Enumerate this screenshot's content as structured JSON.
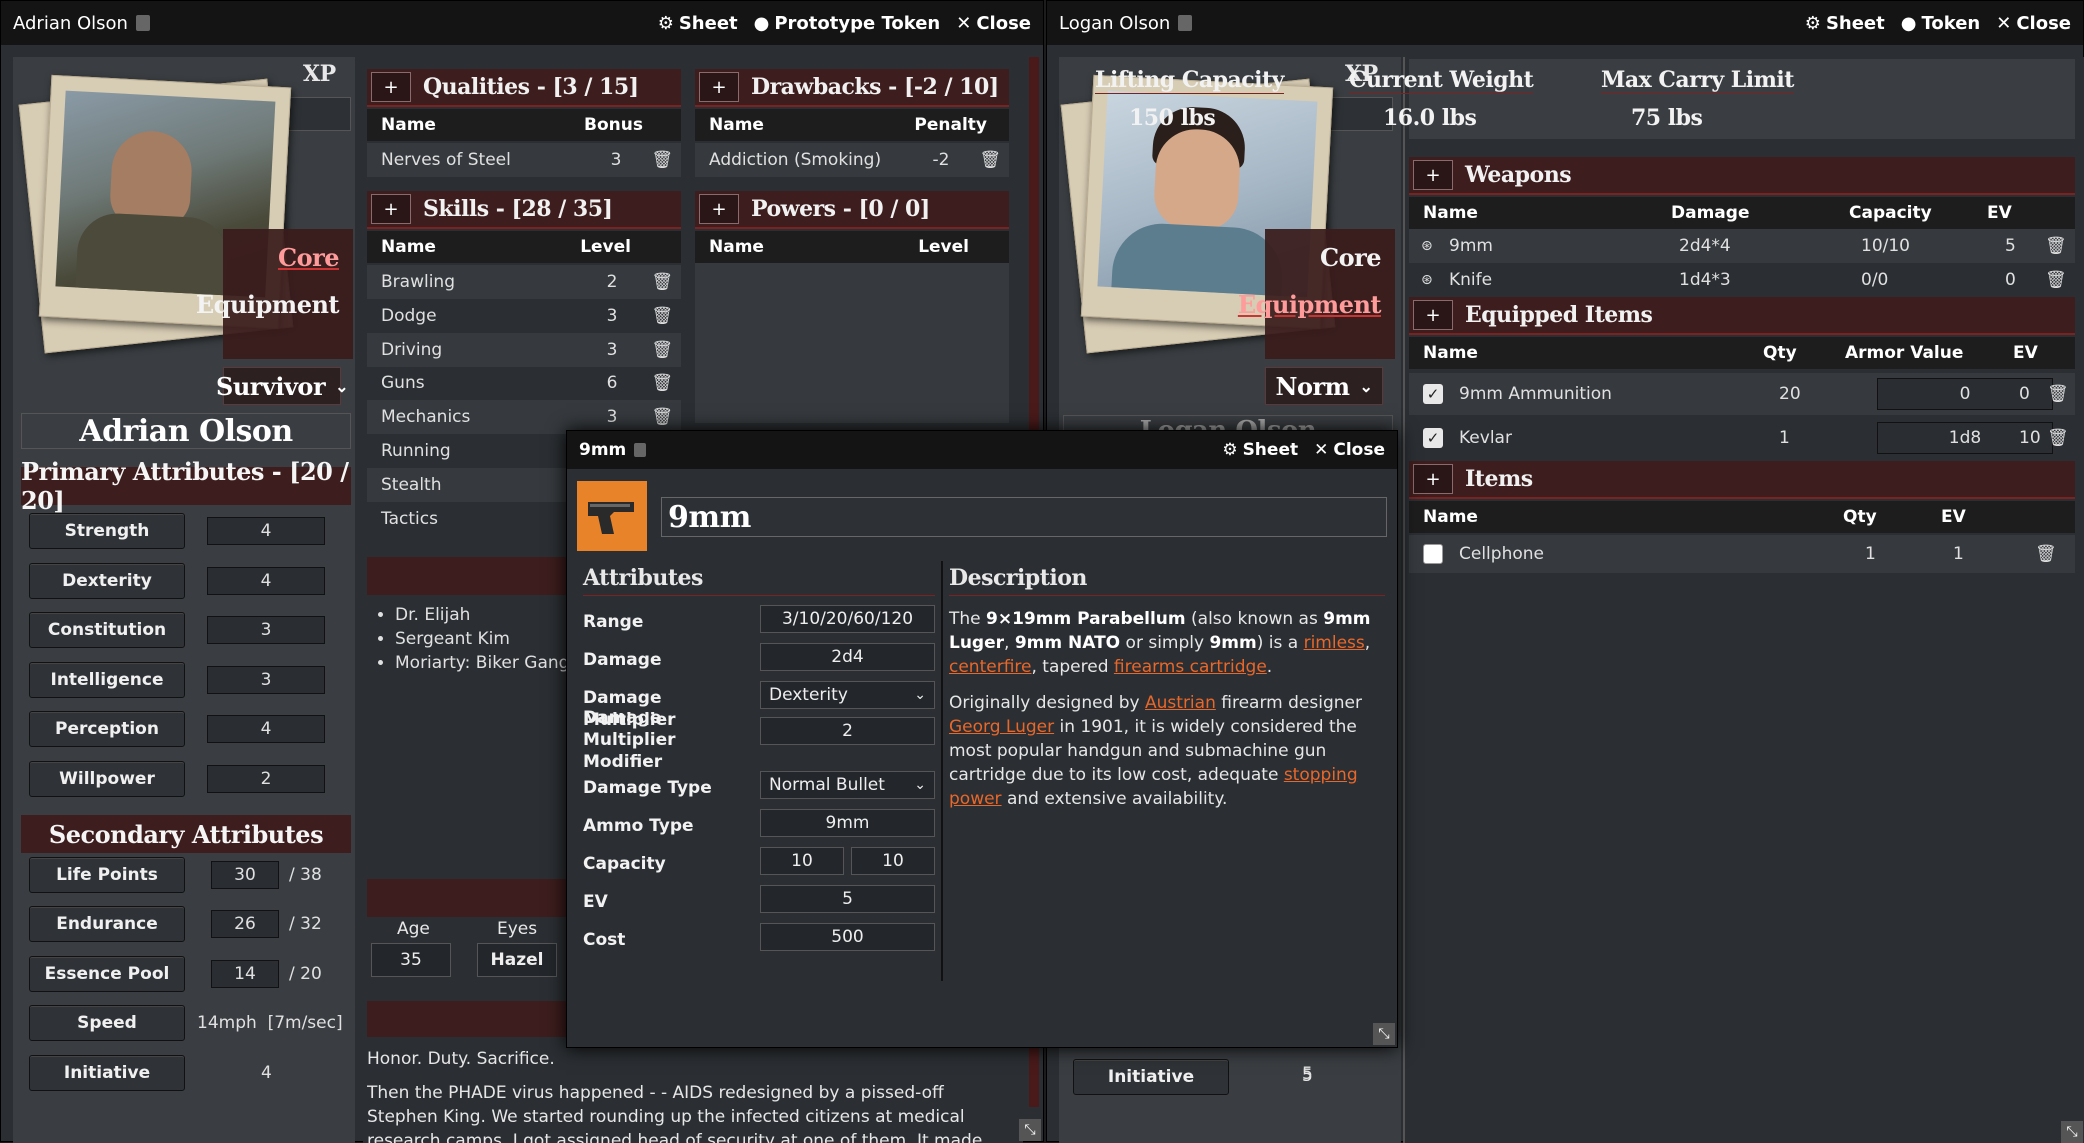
{
  "adrian": {
    "title": "Adrian Olson",
    "actions": [
      "Sheet",
      "Prototype Token",
      "Close"
    ],
    "xp_label": "XP",
    "name": "Adrian Olson",
    "nav": [
      "Core",
      "Equipment"
    ],
    "archetype": "Survivor",
    "primary_header": "Primary Attributes - [20 / 20]",
    "primary": [
      {
        "label": "Strength",
        "value": "4"
      },
      {
        "label": "Dexterity",
        "value": "4"
      },
      {
        "label": "Constitution",
        "value": "3"
      },
      {
        "label": "Intelligence",
        "value": "3"
      },
      {
        "label": "Perception",
        "value": "4"
      },
      {
        "label": "Willpower",
        "value": "2"
      }
    ],
    "secondary_header": "Secondary Attributes",
    "secondary": [
      {
        "label": "Life Points",
        "value": "30",
        "max": "/ 38"
      },
      {
        "label": "Endurance",
        "value": "26",
        "max": "/ 32"
      },
      {
        "label": "Essence Pool",
        "value": "14",
        "max": "/ 20"
      },
      {
        "label": "Speed",
        "value": "14mph  [7m/sec]",
        "max": ""
      },
      {
        "label": "Initiative",
        "value": "4",
        "max": ""
      }
    ],
    "qualities": {
      "title": "Qualities - [3 / 15]",
      "cols": [
        "Name",
        "Bonus"
      ],
      "rows": [
        {
          "name": "Nerves of Steel",
          "val": "3"
        }
      ]
    },
    "drawbacks": {
      "title": "Drawbacks - [-2 / 10]",
      "cols": [
        "Name",
        "Penalty"
      ],
      "rows": [
        {
          "name": "Addiction (Smoking)",
          "val": "-2"
        }
      ]
    },
    "skills": {
      "title": "Skills - [28 / 35]",
      "cols": [
        "Name",
        "Level"
      ],
      "rows": [
        {
          "name": "Brawling",
          "val": "2"
        },
        {
          "name": "Dodge",
          "val": "3"
        },
        {
          "name": "Driving",
          "val": "3"
        },
        {
          "name": "Guns",
          "val": "6"
        },
        {
          "name": "Mechanics",
          "val": "3"
        },
        {
          "name": "Running",
          "val": ""
        },
        {
          "name": "Stealth",
          "val": ""
        },
        {
          "name": "Tactics",
          "val": ""
        }
      ]
    },
    "powers": {
      "title": "Powers - [0 / 0]",
      "cols": [
        "Name",
        "Level"
      ]
    },
    "contacts": [
      "Dr. Elijah",
      "Sergeant Kim",
      "Moriarty: Biker Gang"
    ],
    "bio": {
      "age_label": "Age",
      "age": "35",
      "eyes_label": "Eyes",
      "eyes": "Hazel"
    },
    "motto": "Honor. Duty. Sacrifice.",
    "story": "Then the PHADE virus happened - - AIDS redesigned by a pissed-off Stephen King. We started rounding up the infected citizens at medical research camps. I got assigned head of security at one of them. It made me proud."
  },
  "logan": {
    "title": "Logan Olson",
    "actions": [
      "Sheet",
      "Token",
      "Close"
    ],
    "xp_label": "XP",
    "nav": [
      "Core",
      "Equipment"
    ],
    "archetype": "Norm",
    "name_partial": "Logan Olson",
    "initiative_label": "Initiative",
    "initiative": "5",
    "capacity": [
      {
        "label": "Lifting Capacity",
        "value": "150 lbs"
      },
      {
        "label": "Current Weight",
        "value": "16.0 lbs"
      },
      {
        "label": "Max Carry Limit",
        "value": "75 lbs"
      }
    ],
    "weapons": {
      "title": "Weapons",
      "cols": [
        "Name",
        "Damage",
        "Capacity",
        "EV"
      ],
      "rows": [
        {
          "name": "9mm",
          "damage": "2d4*4",
          "capacity": "10/10",
          "ev": "5"
        },
        {
          "name": "Knife",
          "damage": "1d4*3",
          "capacity": "0/0",
          "ev": "0"
        }
      ]
    },
    "equipped": {
      "title": "Equipped Items",
      "cols": [
        "Name",
        "Qty",
        "Armor Value",
        "EV"
      ],
      "rows": [
        {
          "name": "9mm Ammunition",
          "qty": "20",
          "armor": "0",
          "ev": "0"
        },
        {
          "name": "Kevlar",
          "qty": "1",
          "armor": "1d8",
          "ev": "10"
        }
      ]
    },
    "items": {
      "title": "Items",
      "cols": [
        "Name",
        "Qty",
        "EV"
      ],
      "rows": [
        {
          "name": "Cellphone",
          "qty": "1",
          "ev": "1"
        }
      ]
    }
  },
  "item": {
    "title": "9mm",
    "actions": [
      "Sheet",
      "Close"
    ],
    "name": "9mm",
    "attr_header": "Attributes",
    "desc_header": "Description",
    "fields": [
      {
        "label": "Range",
        "value": "3/10/20/60/120"
      },
      {
        "label": "Damage",
        "value": "2d4"
      },
      {
        "label": "Damage Multiplier",
        "value": "Dexterity",
        "select": true
      },
      {
        "label": "Damage Multiplier Modifier",
        "value": "2"
      },
      {
        "label": "Damage Type",
        "value": "Normal Bullet",
        "select": true
      },
      {
        "label": "Ammo Type",
        "value": "9mm"
      },
      {
        "label": "Capacity",
        "value": "10",
        "value2": "10"
      },
      {
        "label": "EV",
        "value": "5"
      },
      {
        "label": "Cost",
        "value": "500"
      }
    ],
    "desc": {
      "p1a": "The ",
      "p1b": "9×19mm Parabellum",
      "p1c": " (also known as ",
      "p1d": "9mm Luger",
      "p1e": ", ",
      "p1f": "9mm NATO",
      "p1g": " or simply ",
      "p1h": "9mm",
      "p1i": ") is a ",
      "l1": "rimless",
      "s1": ", ",
      "l2": "centerfire",
      "s2": ", tapered ",
      "l3": "firearms cartridge",
      "s3": ".",
      "p2a": "Originally designed by ",
      "l4": "Austrian",
      "p2b": " firearm designer ",
      "l5": "Georg Luger",
      "p2c": " in 1901, it is widely considered the most popular handgun and submachine gun cartridge due to its low cost, adequate ",
      "l6": "stopping power",
      "p2d": " and extensive availability."
    }
  }
}
